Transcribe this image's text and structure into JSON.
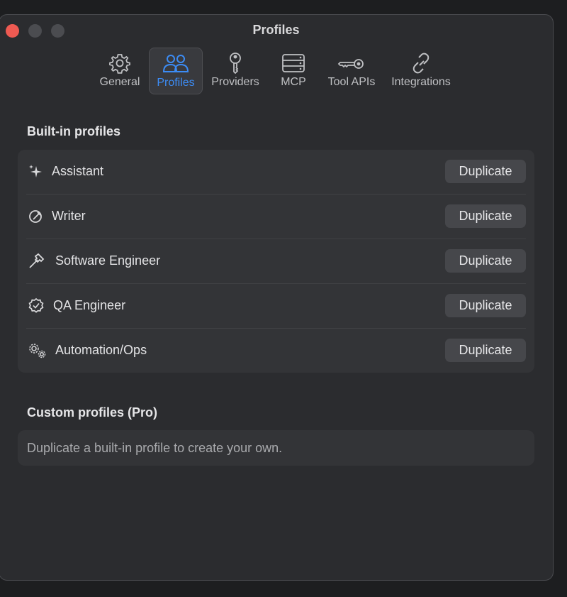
{
  "window": {
    "title": "Profiles"
  },
  "toolbar": {
    "tabs": [
      {
        "label": "General",
        "icon": "gear-icon",
        "active": false
      },
      {
        "label": "Profiles",
        "icon": "people-icon",
        "active": true
      },
      {
        "label": "Providers",
        "icon": "key-icon",
        "active": false
      },
      {
        "label": "MCP",
        "icon": "server-icon",
        "active": false
      },
      {
        "label": "Tool APIs",
        "icon": "api-key-icon",
        "active": false
      },
      {
        "label": "Integrations",
        "icon": "link-icon",
        "active": false
      }
    ],
    "active_color": "#3c8cf5"
  },
  "builtin": {
    "heading": "Built-in profiles",
    "button_label": "Duplicate",
    "profiles": [
      {
        "name": "Assistant",
        "icon": "sparkle-icon"
      },
      {
        "name": "Writer",
        "icon": "compass-pen-icon"
      },
      {
        "name": "Software Engineer",
        "icon": "hammer-icon"
      },
      {
        "name": "QA Engineer",
        "icon": "checkmark-seal-icon"
      },
      {
        "name": "Automation/Ops",
        "icon": "gears-icon"
      }
    ]
  },
  "custom": {
    "heading": "Custom profiles (Pro)",
    "empty_text": "Duplicate a built-in profile to create your own."
  },
  "colors": {
    "close": "#ee5a52",
    "window_bg": "#2b2c2f",
    "panel_bg": "#333437",
    "button_bg": "#46474b"
  }
}
